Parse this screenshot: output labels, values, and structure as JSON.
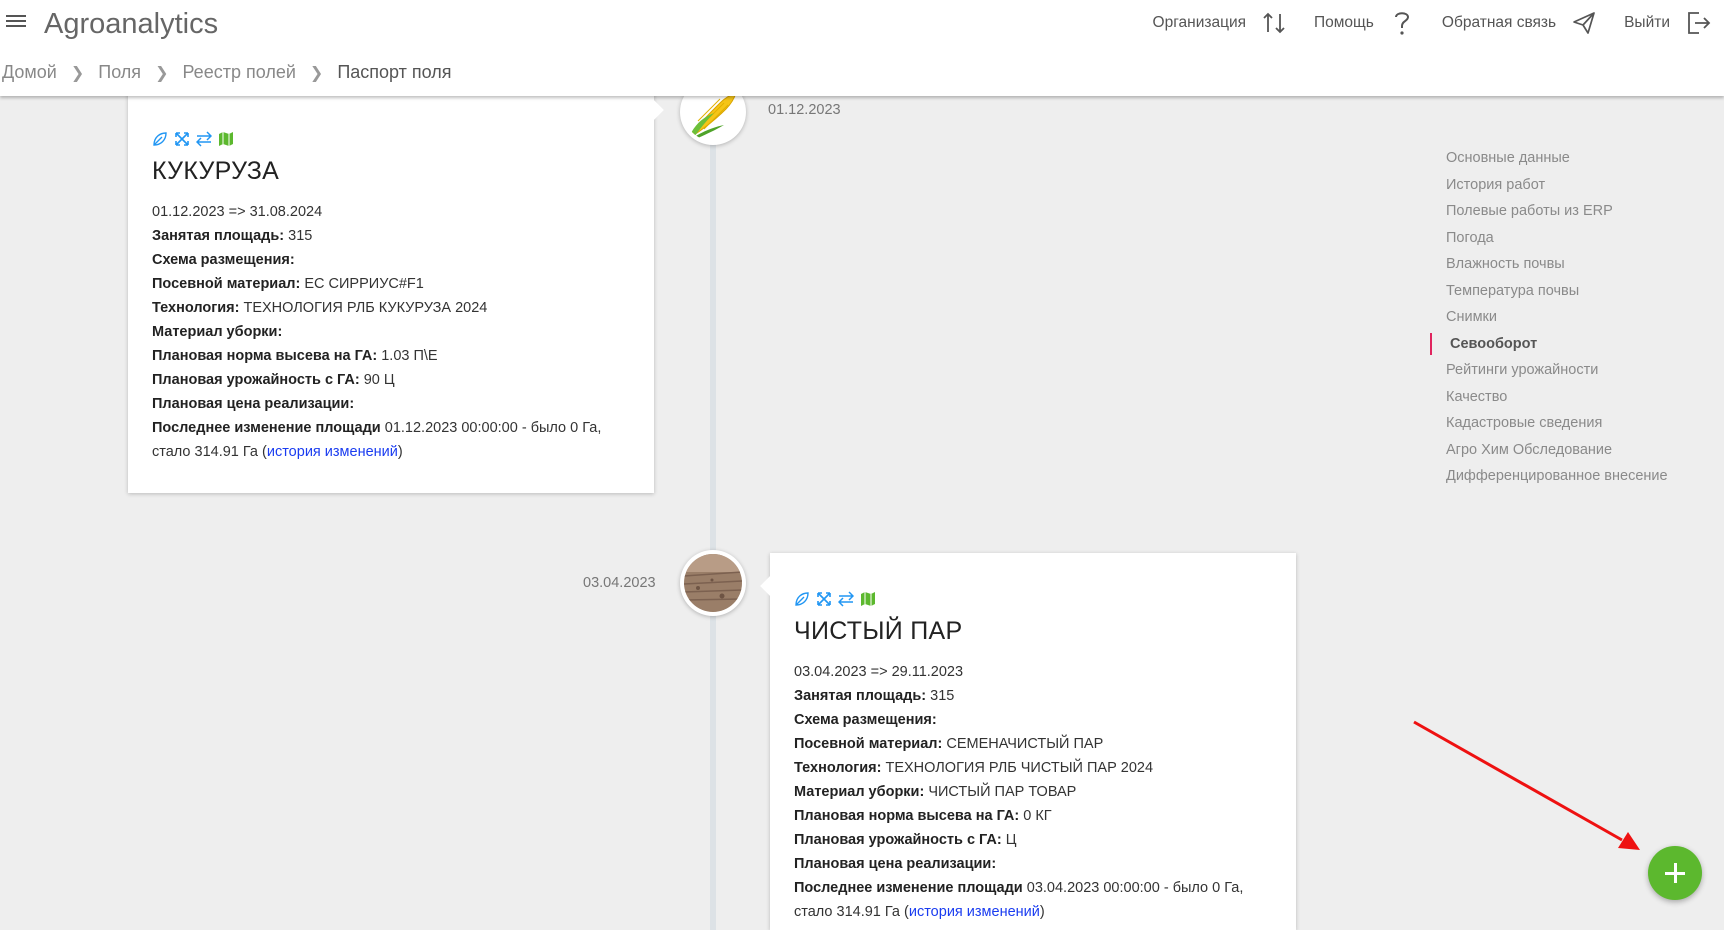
{
  "header": {
    "app_title": "Agroanalytics",
    "actions": [
      {
        "label": "Организация",
        "icon": "swap-vertical-icon"
      },
      {
        "label": "Помощь",
        "icon": "question-icon"
      },
      {
        "label": "Обратная связь",
        "icon": "paper-plane-icon"
      },
      {
        "label": "Выйти",
        "icon": "logout-icon"
      }
    ]
  },
  "breadcrumb": {
    "items": [
      "Домой",
      "Поля",
      "Реестр полей"
    ],
    "current": "Паспорт поля"
  },
  "timeline": [
    {
      "date": "01.12.2023",
      "image": "corn-icon",
      "title": "КУКУРУЗА",
      "period": "01.12.2023 => 31.08.2024",
      "fields": [
        {
          "label": "Занятая площадь:",
          "value": "315"
        },
        {
          "label": "Схема размещения:",
          "value": ""
        },
        {
          "label": "Посевной материал:",
          "value": "ЕС СИРРИУС#F1"
        },
        {
          "label": "Технология:",
          "value": "ТЕХНОЛОГИЯ РЛБ КУКУРУЗА 2024"
        },
        {
          "label": "Материал уборки:",
          "value": ""
        },
        {
          "label": "Плановая норма высева на ГА:",
          "value": "1.03 П\\Е"
        },
        {
          "label": "Плановая урожайность с ГА:",
          "value": "90 Ц"
        },
        {
          "label": "Плановая цена реализации:",
          "value": ""
        }
      ],
      "area_change": {
        "label": "Последнее изменение площади",
        "value": "01.12.2023 00:00:00 - было 0 Га,",
        "value2": "стало 314.91 Га (",
        "link": "история изменений",
        "tail": ")"
      }
    },
    {
      "date": "03.04.2023",
      "image": "bare-soil-image",
      "title": "ЧИСТЫЙ ПАР",
      "period": "03.04.2023 => 29.11.2023",
      "fields": [
        {
          "label": "Занятая площадь:",
          "value": "315"
        },
        {
          "label": "Схема размещения:",
          "value": ""
        },
        {
          "label": "Посевной материал:",
          "value": "СЕМЕНАЧИСТЫЙ ПАР"
        },
        {
          "label": "Технология:",
          "value": "ТЕХНОЛОГИЯ РЛБ ЧИСТЫЙ ПАР 2024"
        },
        {
          "label": "Материал уборки:",
          "value": "ЧИСТЫЙ ПАР ТОВАР"
        },
        {
          "label": "Плановая норма высева на ГА:",
          "value": "0 КГ"
        },
        {
          "label": "Плановая урожайность с ГА:",
          "value": "Ц"
        },
        {
          "label": "Плановая цена реализации:",
          "value": ""
        }
      ],
      "area_change": {
        "label": "Последнее изменение площади",
        "value": "03.04.2023 00:00:00 - было 0 Га,",
        "value2": "стало 314.91 Га (",
        "link": "история изменений",
        "tail": ")"
      }
    }
  ],
  "side_nav": {
    "items": [
      "Основные данные",
      "История работ",
      "Полевые работы из ERP",
      "Погода",
      "Влажность почвы",
      "Температура почвы",
      "Снимки",
      "Севооборот",
      "Рейтинги урожайности",
      "Качество",
      "Кадастровые сведения",
      "Агро Хим Обследование",
      "Дифференцированное внесение"
    ],
    "active": "Севооборот"
  },
  "colors": {
    "accent_green": "#5cb82e",
    "link_blue": "#1a3cf0",
    "active_marker": "#e0245e",
    "annotation_red": "#ee1111"
  }
}
